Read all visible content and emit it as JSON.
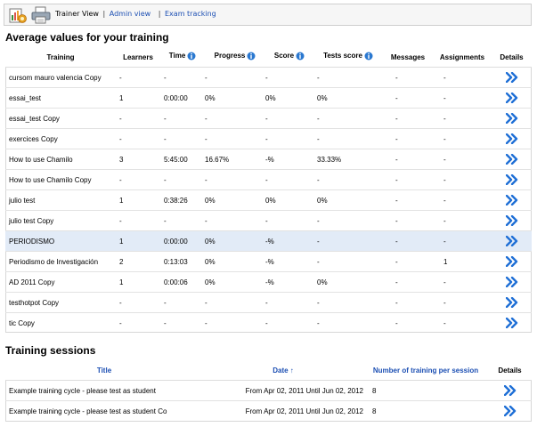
{
  "toolbar": {
    "current_view": "Trainer View",
    "links": [
      "Admin view",
      "Exam tracking"
    ],
    "separator": "|"
  },
  "average": {
    "title": "Average values for your training",
    "columns": [
      "Training",
      "Learners",
      "Time",
      "Progress",
      "Score",
      "Tests score",
      "Messages",
      "Assignments",
      "Details"
    ],
    "rows": [
      {
        "name": "cursom mauro valencia Copy",
        "learners": "-",
        "time": "-",
        "progress": "-",
        "score": "-",
        "tests": "-",
        "messages": "-",
        "assignments": "-"
      },
      {
        "name": "essai_test",
        "learners": "1",
        "time": "0:00:00",
        "progress": "0%",
        "score": "0%",
        "tests": "0%",
        "messages": "-",
        "assignments": "-"
      },
      {
        "name": "essai_test Copy",
        "learners": "-",
        "time": "-",
        "progress": "-",
        "score": "-",
        "tests": "-",
        "messages": "-",
        "assignments": "-"
      },
      {
        "name": "exercices Copy",
        "learners": "-",
        "time": "-",
        "progress": "-",
        "score": "-",
        "tests": "-",
        "messages": "-",
        "assignments": "-"
      },
      {
        "name": "How to use Chamilo",
        "learners": "3",
        "time": "5:45:00",
        "progress": "16.67%",
        "score": "-%",
        "tests": "33.33%",
        "messages": "-",
        "assignments": "-"
      },
      {
        "name": "How to use Chamilo Copy",
        "learners": "-",
        "time": "-",
        "progress": "-",
        "score": "-",
        "tests": "-",
        "messages": "-",
        "assignments": "-"
      },
      {
        "name": "julio test",
        "learners": "1",
        "time": "0:38:26",
        "progress": "0%",
        "score": "0%",
        "tests": "0%",
        "messages": "-",
        "assignments": "-"
      },
      {
        "name": "julio test Copy",
        "learners": "-",
        "time": "-",
        "progress": "-",
        "score": "-",
        "tests": "-",
        "messages": "-",
        "assignments": "-"
      },
      {
        "name": "PERIODISMO",
        "learners": "1",
        "time": "0:00:00",
        "progress": "0%",
        "score": "-%",
        "tests": "-",
        "messages": "-",
        "assignments": "-",
        "highlight": true
      },
      {
        "name": "Periodismo de Investigación",
        "learners": "2",
        "time": "0:13:03",
        "progress": "0%",
        "score": "-%",
        "tests": "-",
        "messages": "-",
        "assignments": "1"
      },
      {
        "name": "AD 2011 Copy",
        "learners": "1",
        "time": "0:00:06",
        "progress": "0%",
        "score": "-%",
        "tests": "0%",
        "messages": "-",
        "assignments": "-"
      },
      {
        "name": "testhotpot Copy",
        "learners": "-",
        "time": "-",
        "progress": "-",
        "score": "-",
        "tests": "-",
        "messages": "-",
        "assignments": "-"
      },
      {
        "name": "tic Copy",
        "learners": "-",
        "time": "-",
        "progress": "-",
        "score": "-",
        "tests": "-",
        "messages": "-",
        "assignments": "-"
      }
    ]
  },
  "sessions": {
    "title": "Training sessions",
    "columns": [
      "Title",
      "Date ↑",
      "Number of training per session",
      "Details"
    ],
    "rows": [
      {
        "title": "Example training cycle - please test as student",
        "date": "From Apr 02, 2011 Until Jun 02, 2012",
        "count": "8"
      },
      {
        "title": "Example training cycle - please test as student Co",
        "date": "From Apr 02, 2011 Until Jun 02, 2012",
        "count": "8"
      }
    ]
  },
  "colors": {
    "link": "#1c4fb3",
    "details_arrow": "#1f6fd6",
    "info_icon": "#2a78d0",
    "highlight_row": "#e2ebf7"
  },
  "icons": {
    "toolbar": [
      "chart-export-icon",
      "printer-icon"
    ],
    "info": "info-icon",
    "details": "details-arrow-icon"
  }
}
